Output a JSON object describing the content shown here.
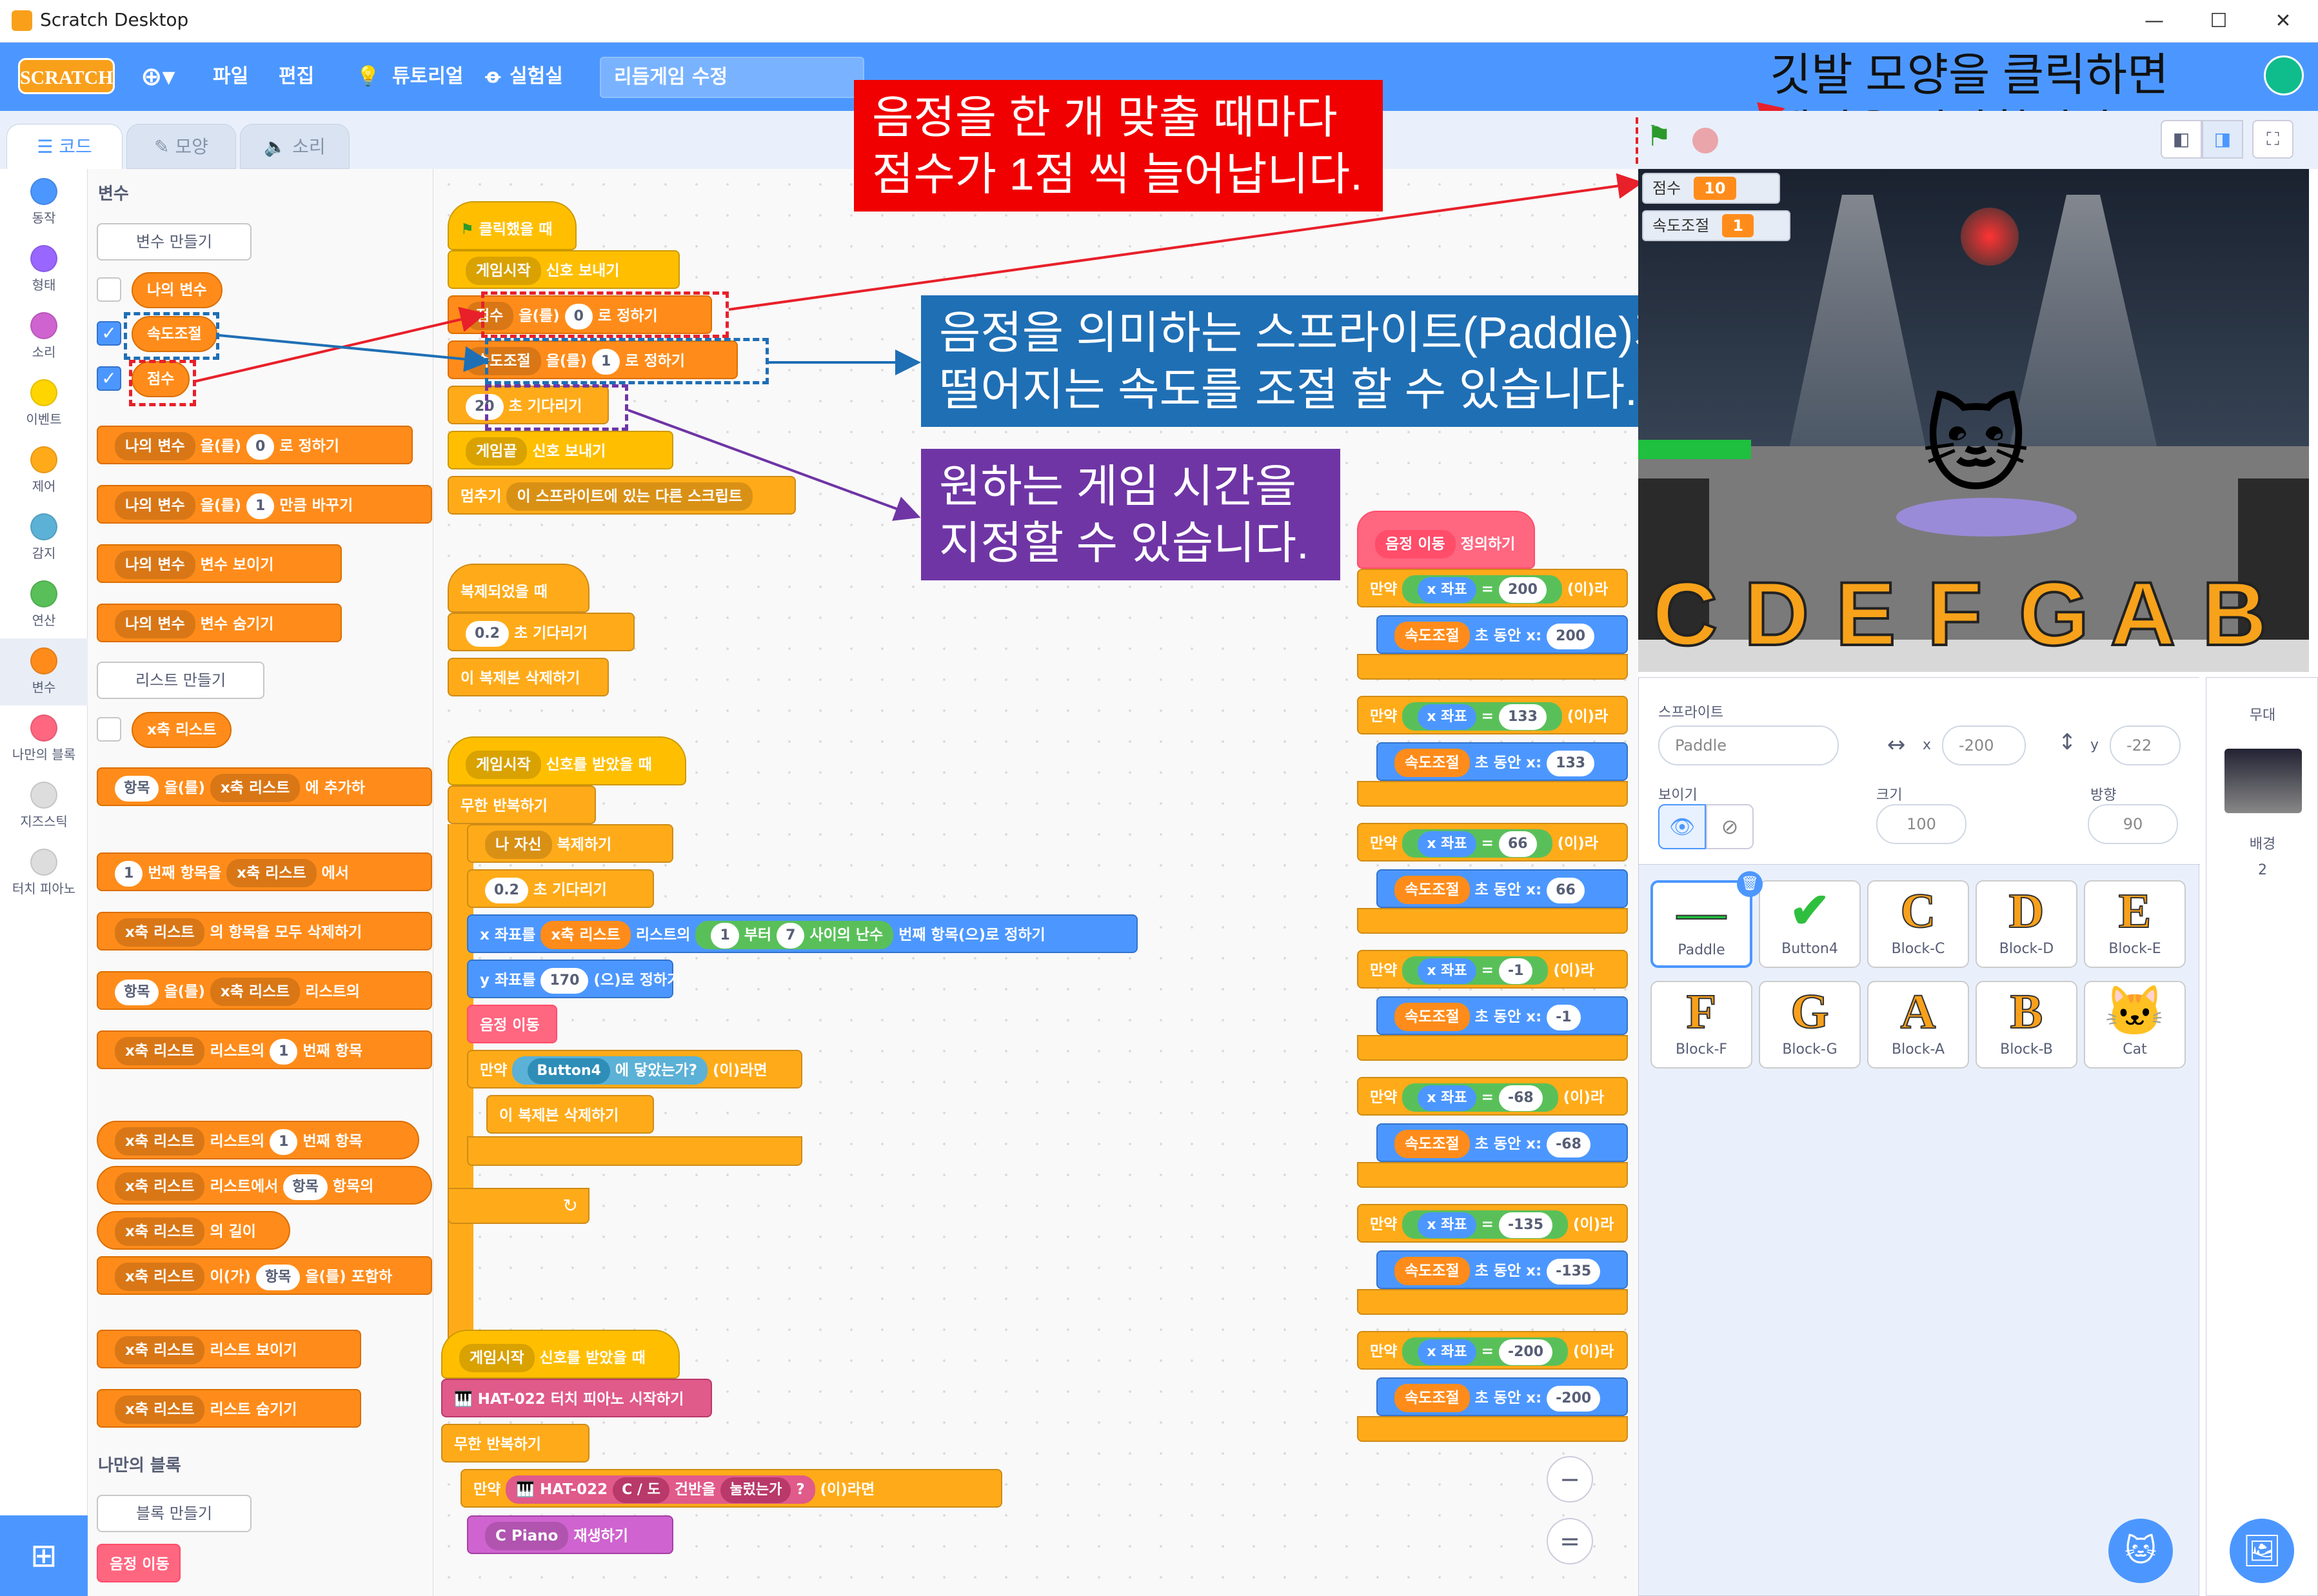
{
  "window": {
    "title": "Scratch Desktop",
    "controls": [
      "—",
      "☐",
      "✕"
    ]
  },
  "menubar": {
    "logo": "SCRATCH",
    "globe": "⊕▾",
    "file": "파일",
    "edit": "편집",
    "tutorials": "튜토리얼",
    "debug": "실험실",
    "project_title": "리듬게임 수정"
  },
  "tabs": {
    "code": "코드",
    "costume": "모양",
    "sound": "소리"
  },
  "categories": [
    {
      "label": "동작",
      "color": "#4c97ff"
    },
    {
      "label": "형태",
      "color": "#9966ff"
    },
    {
      "label": "소리",
      "color": "#cf63cf"
    },
    {
      "label": "이벤트",
      "color": "#ffd500"
    },
    {
      "label": "제어",
      "color": "#ffab19"
    },
    {
      "label": "감지",
      "color": "#5cb1d6"
    },
    {
      "label": "연산",
      "color": "#59c059"
    },
    {
      "label": "변수",
      "color": "#ff8c1a"
    },
    {
      "label": "나만의 블록",
      "color": "#ff6680"
    },
    {
      "label": "지즈스틱",
      "color": "#dddddd"
    },
    {
      "label": "터치 피아노",
      "color": "#dddddd"
    }
  ],
  "palette": {
    "heading_variables": "변수",
    "make_variable": "변수 만들기",
    "vars": [
      "나의 변수",
      "속도조절",
      "점수"
    ],
    "var_set": {
      "name": "나의 변수",
      "mid": "을(를)",
      "val": "0",
      "end": "로 정하기"
    },
    "var_change": {
      "name": "나의 변수",
      "mid": "을(를)",
      "val": "1",
      "end": "만큼 바꾸기"
    },
    "var_show": {
      "name": "나의 변수",
      "end": "변수 보이기"
    },
    "var_hide": {
      "name": "나의 변수",
      "end": "변수 숨기기"
    },
    "make_list": "리스트 만들기",
    "list_name": "x축 리스트",
    "list_add": {
      "item": "항목",
      "mid": "을(를)",
      "list": "x축 리스트",
      "end": "에 추가하"
    },
    "list_delete": {
      "num": "1",
      "a": "번째 항목을",
      "list": "x축 리스트",
      "end": "에서"
    },
    "list_delete_all": {
      "list": "x축 리스트",
      "end": "의 항목을 모두 삭제하기"
    },
    "list_insert": {
      "item": "항목",
      "mid": "을(를)",
      "list": "x축 리스트",
      "end": "리스트의"
    },
    "list_replace": {
      "list": "x축 리스트",
      "mid": "리스트의",
      "num": "1",
      "end": "번째 항목"
    },
    "list_item": {
      "list": "x축 리스트",
      "mid": "리스트의",
      "num": "1",
      "end": "번째 항목"
    },
    "list_index": {
      "list": "x축 리스트",
      "mid": "리스트에서",
      "item": "항목",
      "end": "항목의"
    },
    "list_length": {
      "list": "x축 리스트",
      "end": "의 길이"
    },
    "list_contains": {
      "list": "x축 리스트",
      "mid": "이(가)",
      "item": "항목",
      "end": "을(를) 포함하"
    },
    "list_show": {
      "list": "x축 리스트",
      "end": "리스트 보이기"
    },
    "list_hide": {
      "list": "x축 리스트",
      "end": "리스트 숨기기"
    },
    "heading_my": "나만의 블록",
    "make_block": "블록 만들기",
    "my_block": "음정 이동"
  },
  "scripts": {
    "s1": {
      "hat": "클릭했을 때",
      "b1": [
        "게임시작",
        "신호 보내기"
      ],
      "b2": [
        "점수",
        "을(를)",
        "0",
        "로 정하기"
      ],
      "b3": [
        "속도조절",
        "을(를)",
        "1",
        "로 정하기"
      ],
      "b4": [
        "20",
        "초 기다리기"
      ],
      "b5": [
        "게임끝",
        "신호 보내기"
      ],
      "b6": [
        "멈추기",
        "이 스프라이트에 있는 다른 스크립트"
      ]
    },
    "s2": {
      "hat": "복제되었을 때",
      "b1": [
        "0.2",
        "초 기다리기"
      ],
      "b2": "이 복제본 삭제하기"
    },
    "s3": {
      "hat": [
        "게임시작",
        "신호를 받았을 때"
      ],
      "loop": "무한 반복하기",
      "b1": [
        "나 자신",
        "복제하기"
      ],
      "b2": [
        "0.2",
        "초 기다리기"
      ],
      "b3": [
        "x 좌표를",
        "x축 리스트",
        "리스트의",
        "1",
        "부터",
        "7",
        "사이의 난수",
        "번째 항목",
        "(으)로 정하기"
      ],
      "b4": [
        "y 좌표를",
        "170",
        "(으)로 정하기"
      ],
      "b5": "음정 이동",
      "b6": [
        "만약",
        "Button4",
        "에 닿았는가?",
        "(이)라면"
      ],
      "b7": "이 복제본 삭제하기"
    },
    "s4": {
      "hat": [
        "게임시작",
        "신호를 받았을 때"
      ],
      "b1": [
        "HAT-022 터치 피아노 시작하기"
      ],
      "loop": "무한 반복하기",
      "b2": [
        "만약",
        "HAT-022",
        "C / 도",
        "건반을",
        "눌렀는가",
        "?",
        "(이)라면"
      ],
      "b3": [
        "C Piano",
        "재생하기"
      ]
    },
    "s5": {
      "hat": [
        "음정 이동",
        "정의하기"
      ],
      "rows": [
        {
          "v": "200"
        },
        {
          "v": "133"
        },
        {
          "v": "66"
        },
        {
          "v": "-1"
        },
        {
          "v": "-68"
        },
        {
          "v": "-135"
        },
        {
          "v": "-200"
        }
      ],
      "if": "만약",
      "xpos": "x 좌표",
      "eq": "=",
      "then": "(이)라",
      "speed": "속도조절",
      "glide": "초 동안 x:"
    }
  },
  "notes": {
    "n1": "음정을 한 개 맞출 때마다\n점수가 1점 씩 늘어납니다.",
    "n2": "음정을 의미하는 스프라이트(Paddle)가\n떨어지는 속도를 조절 할 수 있습니다.",
    "n3": "원하는 게임 시간을\n지정할 수 있습니다.",
    "n4": "깃발 모양을 클릭하면\n게임을 시작합니다."
  },
  "stage": {
    "monitors": [
      {
        "label": "점수",
        "value": "10"
      },
      {
        "label": "속도조절",
        "value": "1"
      }
    ],
    "letters": [
      "C",
      "D",
      "E",
      "F",
      "G",
      "A",
      "B"
    ]
  },
  "sprite_info": {
    "label": "스프라이트",
    "name": "Paddle",
    "x": "-200",
    "y": "-22",
    "show": "보이기",
    "size_label": "크기",
    "size": "100",
    "dir_label": "방향",
    "dir": "90",
    "x_label": "x",
    "y_label": "y"
  },
  "sprites": [
    {
      "name": "Paddle",
      "glyph": "—"
    },
    {
      "name": "Button4",
      "glyph": "✔"
    },
    {
      "name": "Block-C",
      "glyph": "C"
    },
    {
      "name": "Block-D",
      "glyph": "D"
    },
    {
      "name": "Block-E",
      "glyph": "E"
    },
    {
      "name": "Block-F",
      "glyph": "F"
    },
    {
      "name": "Block-G",
      "glyph": "G"
    },
    {
      "name": "Block-A",
      "glyph": "A"
    },
    {
      "name": "Block-B",
      "glyph": "B"
    },
    {
      "name": "Cat",
      "glyph": "🐱"
    }
  ],
  "backdrop": {
    "label": "무대",
    "sub": "배경",
    "count": "2"
  },
  "zoom": {
    "in": "+",
    "out": "−",
    "reset": "="
  }
}
